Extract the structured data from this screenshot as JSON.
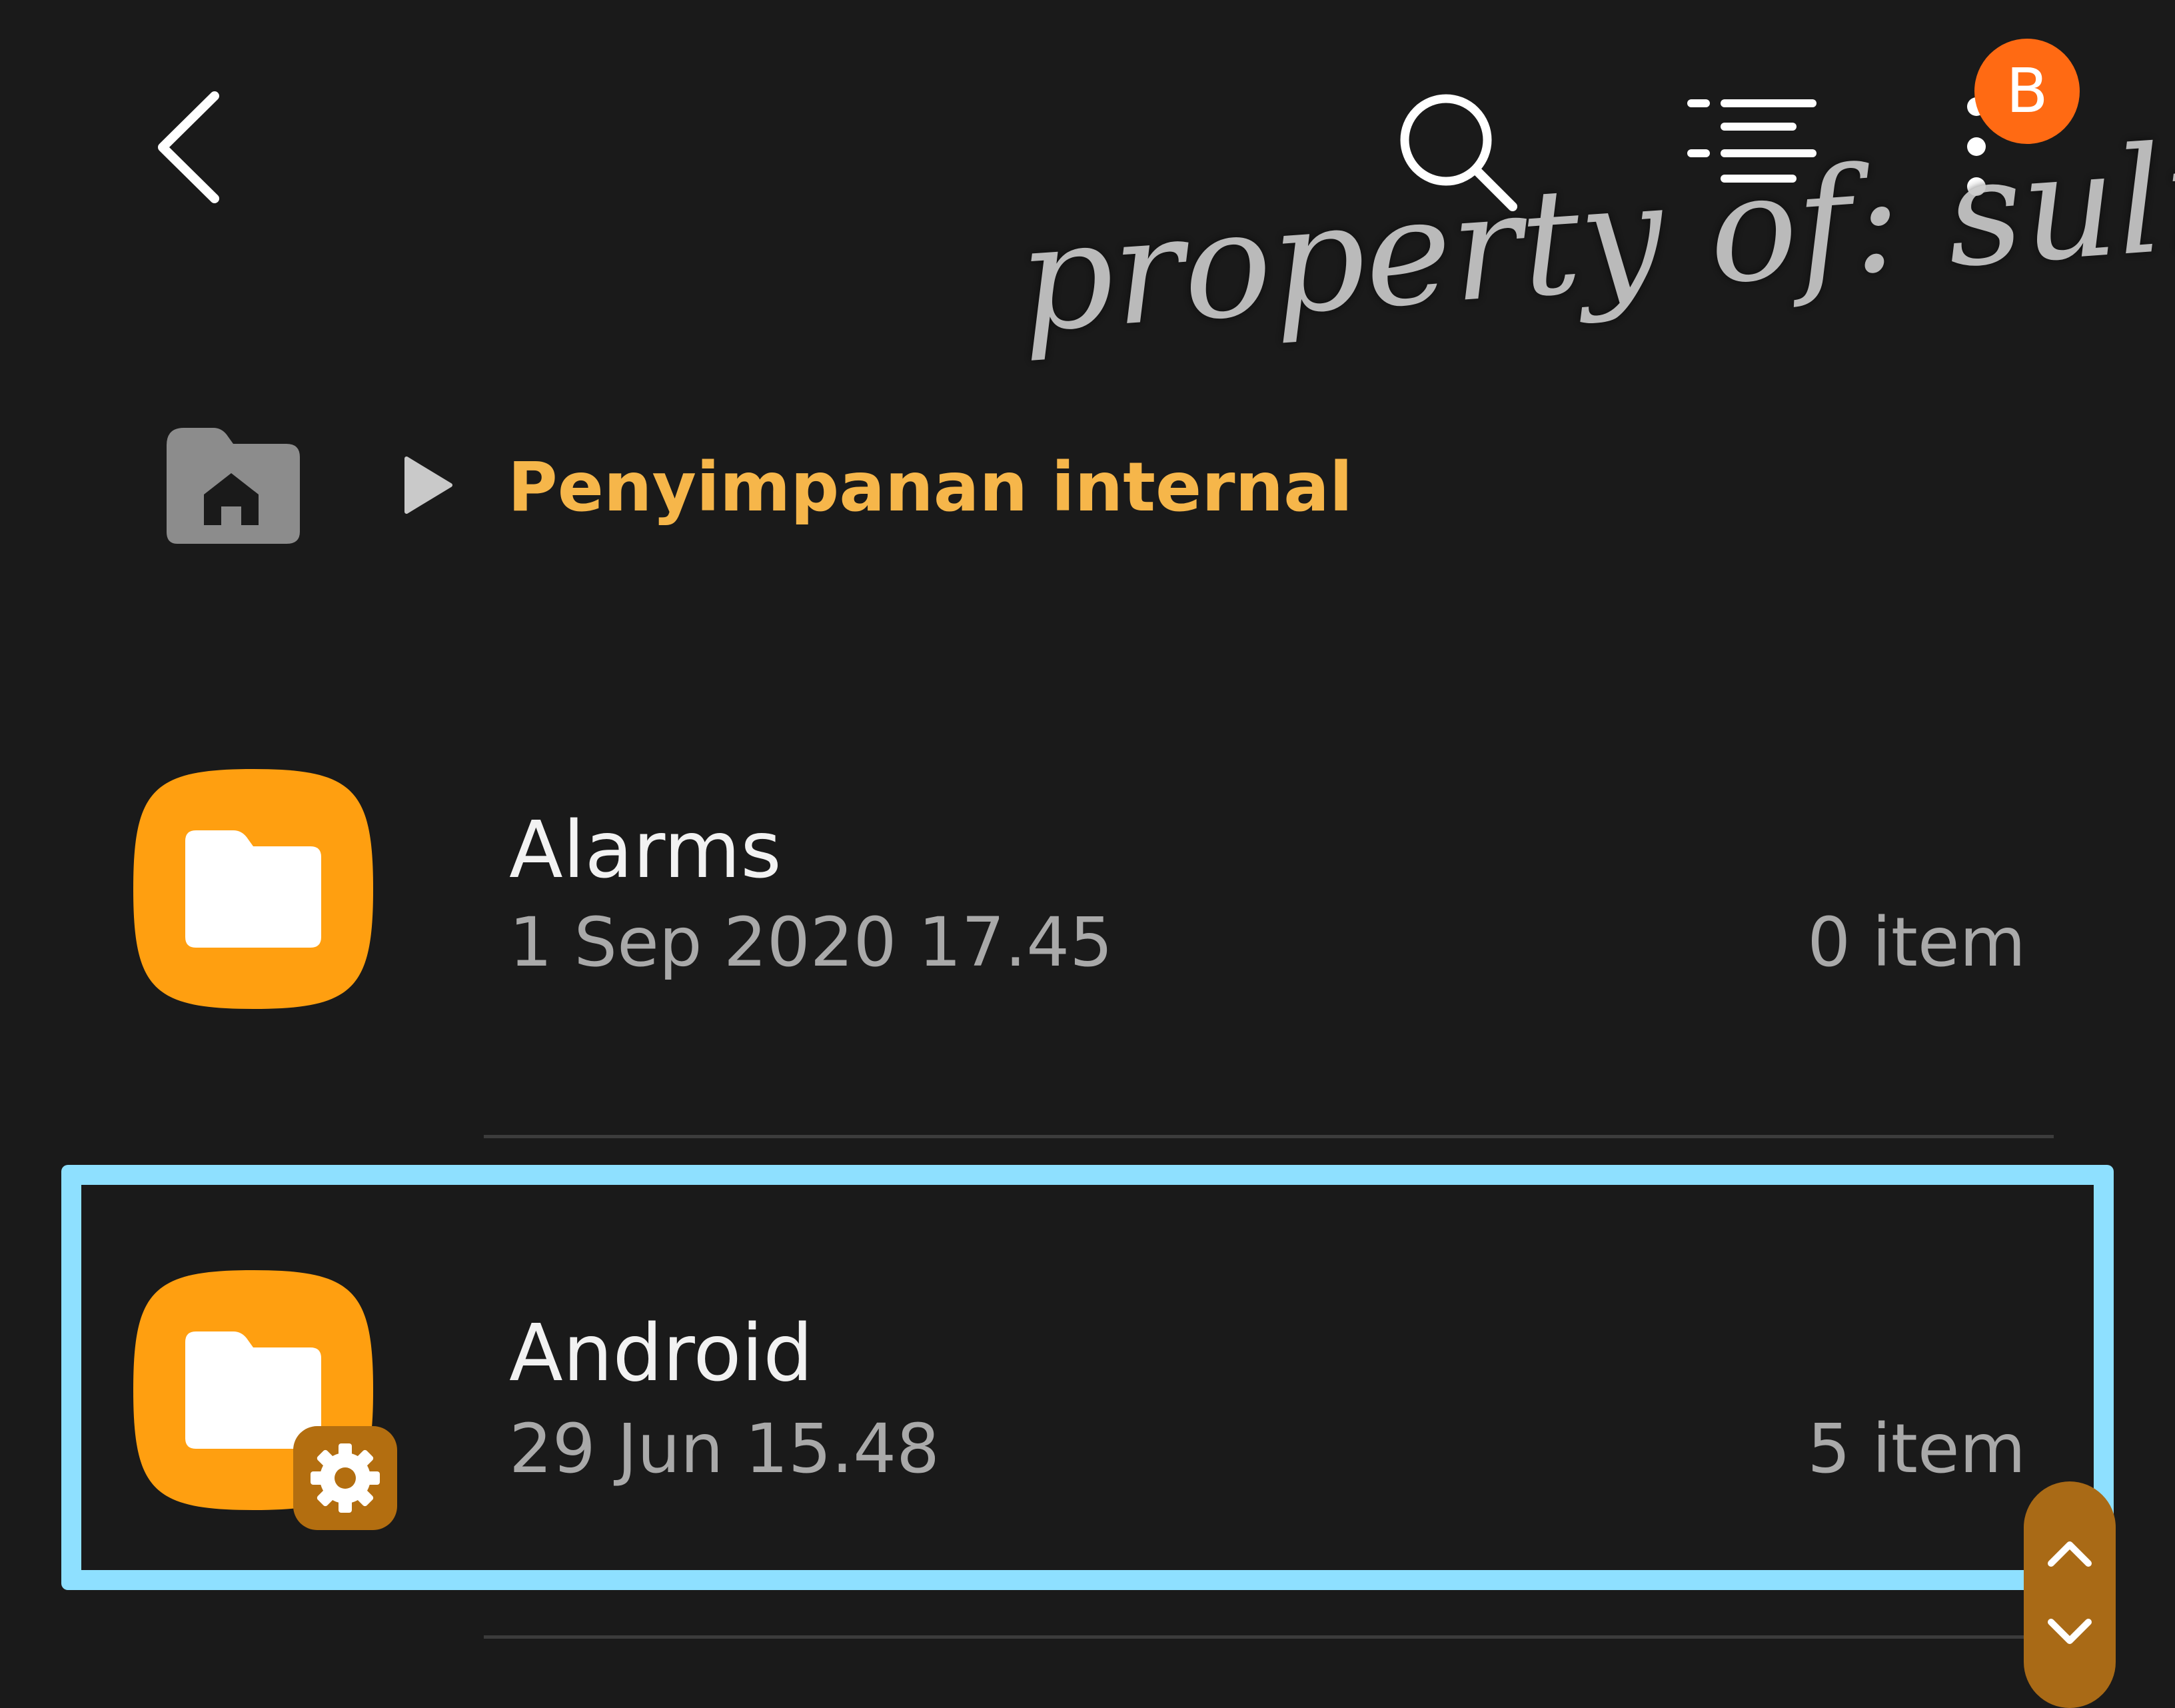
{
  "header": {
    "back_icon": "chevron-left-icon",
    "search_icon": "search-icon",
    "sort_icon": "sort-lines-icon",
    "more_icon": "more-vertical-icon",
    "avatar_letter": "B",
    "avatar_color": "#ff6a13"
  },
  "watermark": {
    "text": "property of: sulmad"
  },
  "breadcrumb": {
    "home_icon": "home-folder-icon",
    "separator_icon": "play-triangle-icon",
    "current": "Penyimpanan internal",
    "accent_color": "#f6b64a"
  },
  "files": [
    {
      "name": "Alarms",
      "date": "1 Sep 2020 17.45",
      "count": "0 item",
      "icon": "folder-icon"
    },
    {
      "name": "Android",
      "date": "29 Jun 15.48",
      "count": "5 item",
      "icon": "folder-icon",
      "badge_icon": "gear-icon"
    }
  ],
  "colors": {
    "background": "#1a1a1a",
    "folder": "#ff9f10",
    "highlight": "#8ee0ff",
    "scroller": "#a96a16"
  },
  "scroller": {
    "up_icon": "chevron-up-icon",
    "down_icon": "chevron-down-icon"
  }
}
